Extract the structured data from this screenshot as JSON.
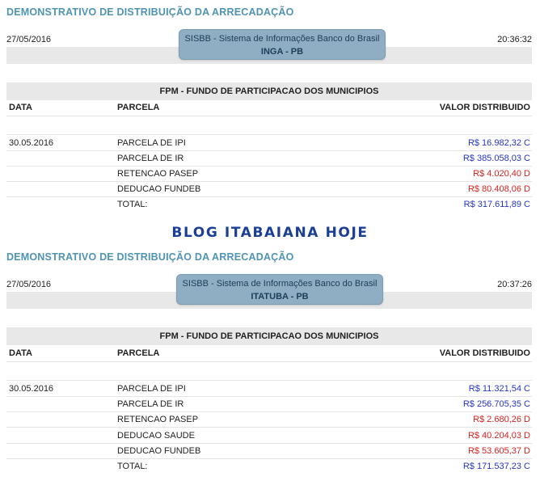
{
  "reports": [
    {
      "title": "DEMONSTRATIVO DE DISTRIBUIÇÃO DA ARRECADAÇÃO",
      "date": "27/05/2016",
      "time": "20:36:32",
      "system": "SISBB - Sistema de Informações Banco do Brasil",
      "municipality": "INGA - PB",
      "fund": "FPM - FUNDO DE PARTICIPACAO DOS MUNICIPIOS",
      "col_data": "DATA",
      "col_parcela": "PARCELA",
      "col_valor": "VALOR DISTRIBUIDO",
      "row_date": "30.05.2016",
      "rows": [
        {
          "parcela": "PARCELA DE IPI",
          "valor": "R$ 16.982,32 C",
          "color": "#2535c6"
        },
        {
          "parcela": "PARCELA DE IR",
          "valor": "R$ 385.058,03 C",
          "color": "#2535c6"
        },
        {
          "parcela": "RETENCAO PASEP",
          "valor": "R$ 4.020,40 D",
          "color": "#d8231f"
        },
        {
          "parcela": "DEDUCAO FUNDEB",
          "valor": "R$ 80.408,06 D",
          "color": "#d8231f"
        },
        {
          "parcela": "TOTAL:",
          "valor": "R$ 317.611,89 C",
          "color": "#2535c6"
        }
      ]
    },
    {
      "title": "DEMONSTRATIVO DE DISTRIBUIÇÃO DA ARRECADAÇÃO",
      "date": "27/05/2016",
      "time": "20:37:26",
      "system": "SISBB - Sistema de Informações Banco do Brasil",
      "municipality": "ITATUBA - PB",
      "fund": "FPM - FUNDO DE PARTICIPACAO DOS MUNICIPIOS",
      "col_data": "DATA",
      "col_parcela": "PARCELA",
      "col_valor": "VALOR DISTRIBUIDO",
      "row_date": "30.05.2016",
      "rows": [
        {
          "parcela": "PARCELA DE IPI",
          "valor": "R$ 11.321,54 C",
          "color": "#2535c6"
        },
        {
          "parcela": "PARCELA DE IR",
          "valor": "R$ 256.705,35 C",
          "color": "#2535c6"
        },
        {
          "parcela": "RETENCAO PASEP",
          "valor": "R$ 2.680,26 D",
          "color": "#d8231f"
        },
        {
          "parcela": "DEDUCAO SAUDE",
          "valor": "R$ 40.204,03 D",
          "color": "#d8231f"
        },
        {
          "parcela": "DEDUCAO FUNDEB",
          "valor": "R$ 53.605,37 D",
          "color": "#d8231f"
        },
        {
          "parcela": "TOTAL:",
          "valor": "R$ 171.537,23 C",
          "color": "#2535c6"
        }
      ]
    }
  ],
  "watermark": "BLOG ITABAIANA HOJE"
}
